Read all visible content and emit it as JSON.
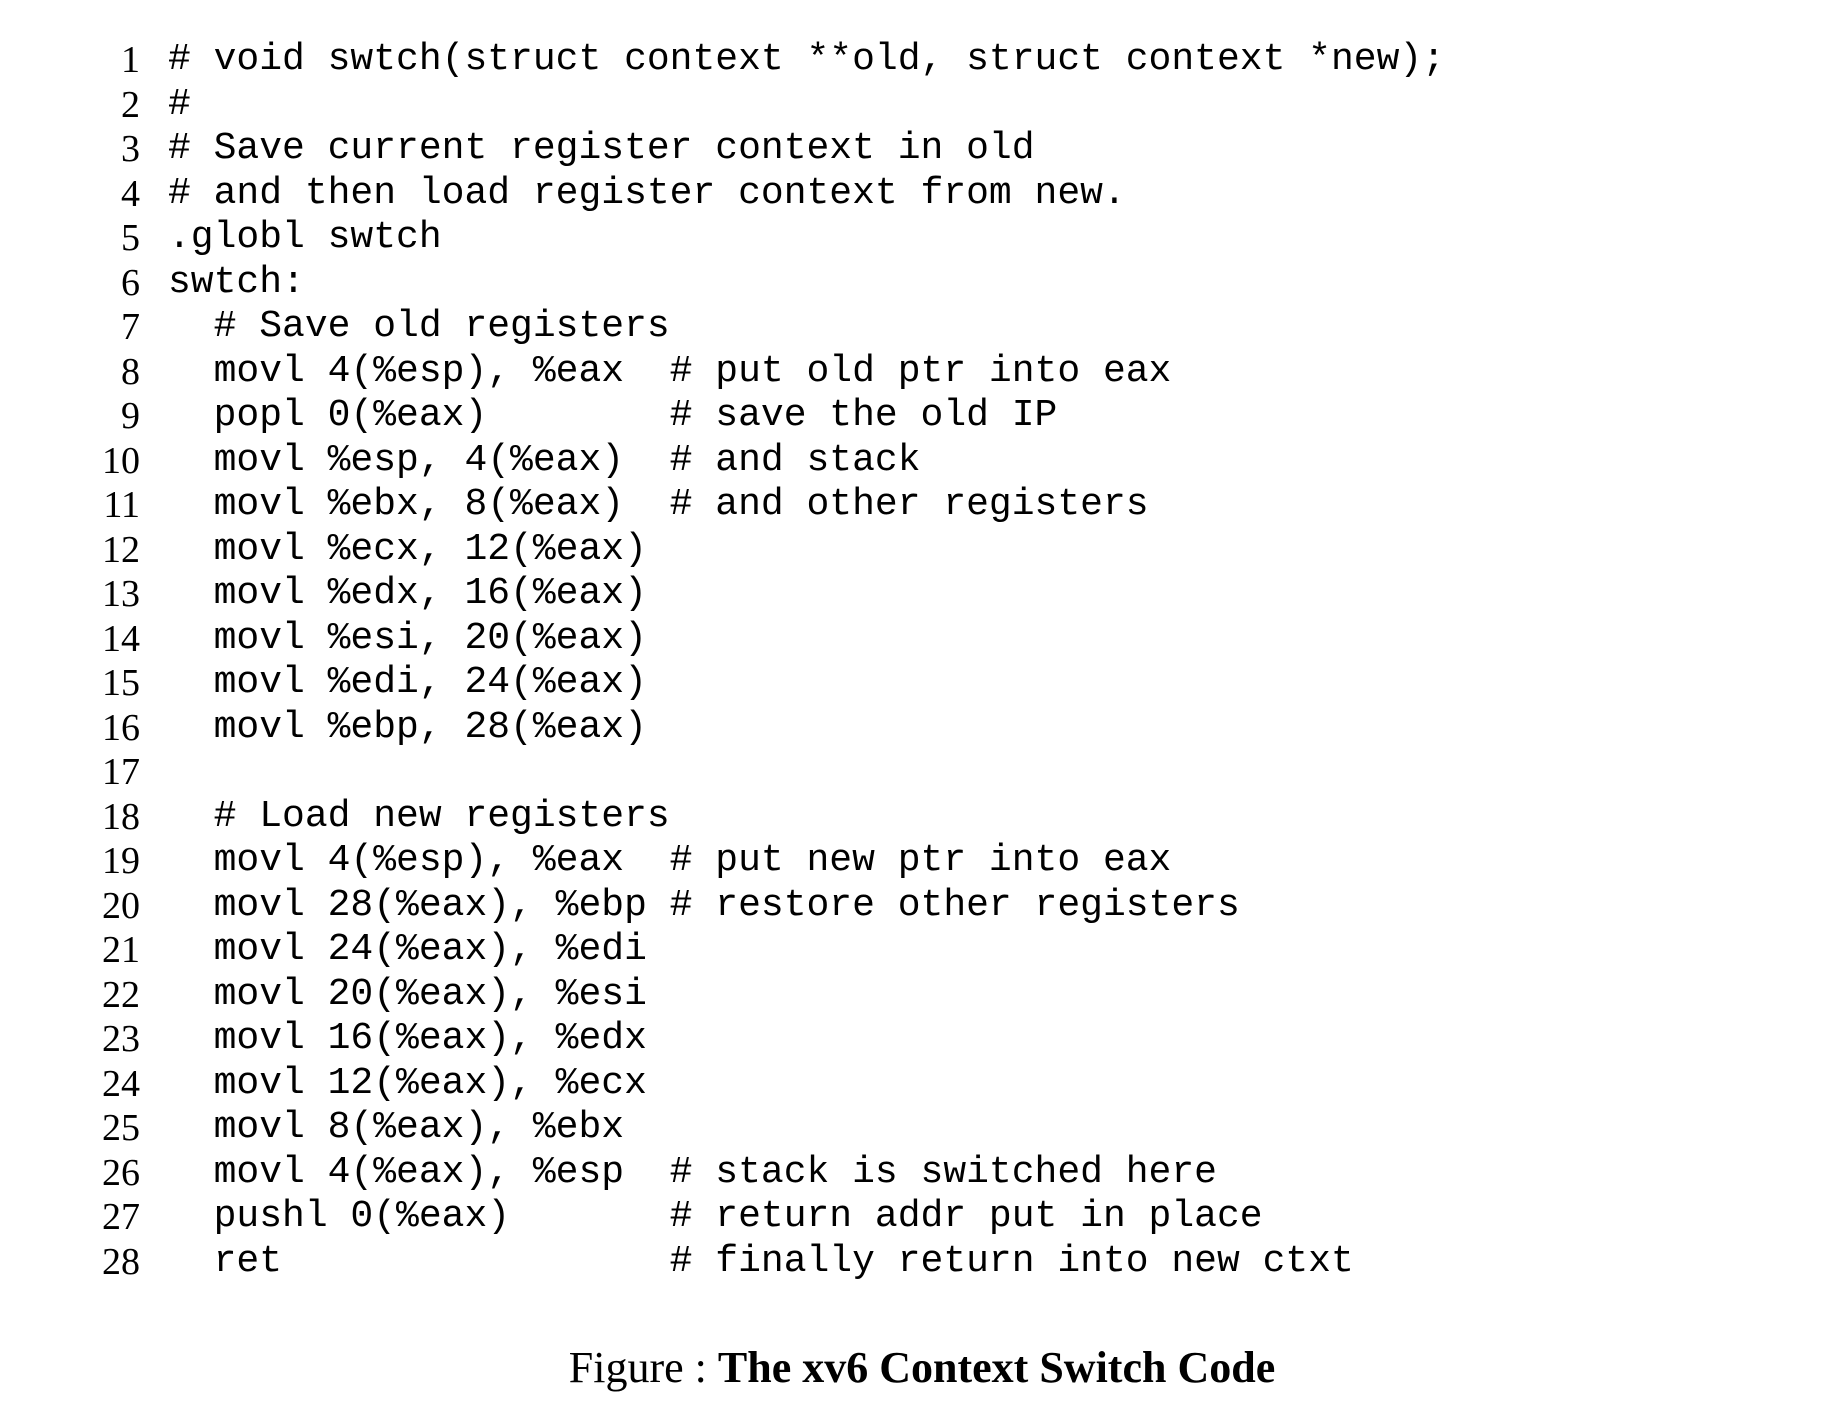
{
  "caption": {
    "figure_prefix": "Figure",
    "figure_number": "",
    "separator": ": ",
    "title": "The xv6 Context Switch Code"
  },
  "lines": [
    {
      "n": "1",
      "text": "# void swtch(struct context **old, struct context *new);"
    },
    {
      "n": "2",
      "text": "#"
    },
    {
      "n": "3",
      "text": "# Save current register context in old"
    },
    {
      "n": "4",
      "text": "# and then load register context from new."
    },
    {
      "n": "5",
      "text": ".globl swtch"
    },
    {
      "n": "6",
      "text": "swtch:"
    },
    {
      "n": "7",
      "text": "  # Save old registers"
    },
    {
      "n": "8",
      "text": "  movl 4(%esp), %eax  # put old ptr into eax"
    },
    {
      "n": "9",
      "text": "  popl 0(%eax)        # save the old IP"
    },
    {
      "n": "10",
      "text": "  movl %esp, 4(%eax)  # and stack"
    },
    {
      "n": "11",
      "text": "  movl %ebx, 8(%eax)  # and other registers"
    },
    {
      "n": "12",
      "text": "  movl %ecx, 12(%eax)"
    },
    {
      "n": "13",
      "text": "  movl %edx, 16(%eax)"
    },
    {
      "n": "14",
      "text": "  movl %esi, 20(%eax)"
    },
    {
      "n": "15",
      "text": "  movl %edi, 24(%eax)"
    },
    {
      "n": "16",
      "text": "  movl %ebp, 28(%eax)"
    },
    {
      "n": "17",
      "text": ""
    },
    {
      "n": "18",
      "text": "  # Load new registers"
    },
    {
      "n": "19",
      "text": "  movl 4(%esp), %eax  # put new ptr into eax"
    },
    {
      "n": "20",
      "text": "  movl 28(%eax), %ebp # restore other registers"
    },
    {
      "n": "21",
      "text": "  movl 24(%eax), %edi"
    },
    {
      "n": "22",
      "text": "  movl 20(%eax), %esi"
    },
    {
      "n": "23",
      "text": "  movl 16(%eax), %edx"
    },
    {
      "n": "24",
      "text": "  movl 12(%eax), %ecx"
    },
    {
      "n": "25",
      "text": "  movl 8(%eax), %ebx"
    },
    {
      "n": "26",
      "text": "  movl 4(%eax), %esp  # stack is switched here"
    },
    {
      "n": "27",
      "text": "  pushl 0(%eax)       # return addr put in place"
    },
    {
      "n": "28",
      "text": "  ret                 # finally return into new ctxt"
    }
  ]
}
